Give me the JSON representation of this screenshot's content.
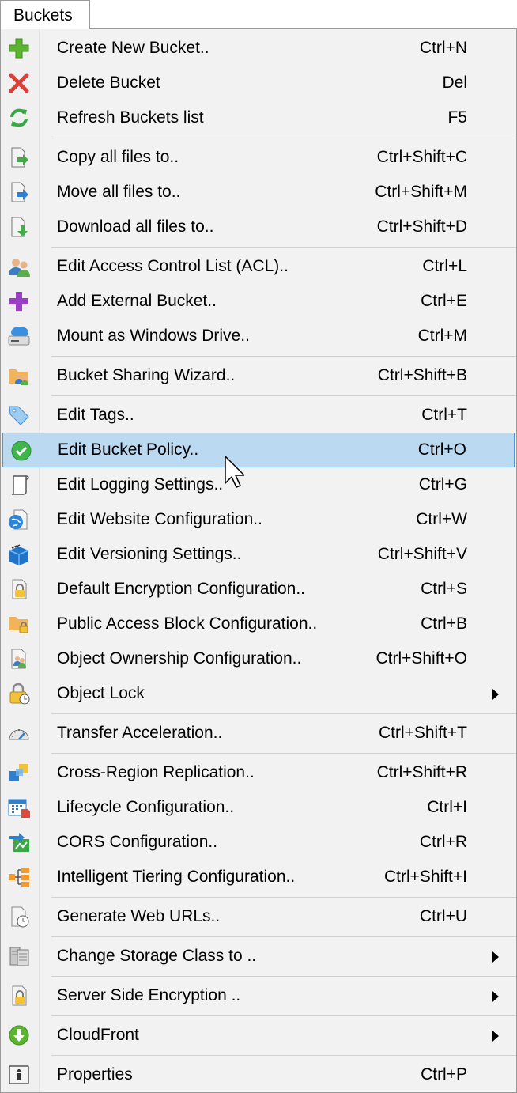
{
  "menu_title": "Buckets",
  "items": [
    {
      "label": "Create New Bucket..",
      "shortcut": "Ctrl+N",
      "icon": "plus-icon"
    },
    {
      "label": "Delete Bucket",
      "shortcut": "Del",
      "icon": "delete-x-icon"
    },
    {
      "label": "Refresh Buckets list",
      "shortcut": "F5",
      "icon": "refresh-icon"
    },
    {
      "label": "Copy all files to..",
      "shortcut": "Ctrl+Shift+C",
      "icon": "copy-files-icon"
    },
    {
      "label": "Move all files to..",
      "shortcut": "Ctrl+Shift+M",
      "icon": "move-files-icon"
    },
    {
      "label": "Download all files to..",
      "shortcut": "Ctrl+Shift+D",
      "icon": "download-files-icon"
    },
    {
      "label": "Edit Access Control List (ACL)..",
      "shortcut": "Ctrl+L",
      "icon": "users-icon"
    },
    {
      "label": "Add External Bucket..",
      "shortcut": "Ctrl+E",
      "icon": "purple-plus-icon"
    },
    {
      "label": "Mount as Windows Drive..",
      "shortcut": "Ctrl+M",
      "icon": "cloud-drive-icon"
    },
    {
      "label": "Bucket Sharing Wizard..",
      "shortcut": "Ctrl+Shift+B",
      "icon": "shared-folder-icon"
    },
    {
      "label": "Edit Tags..",
      "shortcut": "Ctrl+T",
      "icon": "tag-icon"
    },
    {
      "label": "Edit Bucket Policy..",
      "shortcut": "Ctrl+O",
      "icon": "check-circle-icon"
    },
    {
      "label": "Edit Logging Settings..",
      "shortcut": "Ctrl+G",
      "icon": "scroll-icon"
    },
    {
      "label": "Edit Website Configuration..",
      "shortcut": "Ctrl+W",
      "icon": "globe-page-icon"
    },
    {
      "label": "Edit Versioning Settings..",
      "shortcut": "Ctrl+Shift+V",
      "icon": "versioning-box-icon"
    },
    {
      "label": "Default Encryption Configuration..",
      "shortcut": "Ctrl+S",
      "icon": "lock-page-icon"
    },
    {
      "label": "Public Access Block Configuration..",
      "shortcut": "Ctrl+B",
      "icon": "locked-folder-icon"
    },
    {
      "label": "Object Ownership Configuration..",
      "shortcut": "Ctrl+Shift+O",
      "icon": "user-page-icon"
    },
    {
      "label": "Object Lock",
      "shortcut": "",
      "icon": "padlock-clock-icon"
    },
    {
      "label": "Transfer Acceleration..",
      "shortcut": "Ctrl+Shift+T",
      "icon": "speedometer-icon"
    },
    {
      "label": "Cross-Region Replication..",
      "shortcut": "Ctrl+Shift+R",
      "icon": "replication-icon"
    },
    {
      "label": "Lifecycle Configuration..",
      "shortcut": "Ctrl+I",
      "icon": "calendar-icon"
    },
    {
      "label": "CORS Configuration..",
      "shortcut": "Ctrl+R",
      "icon": "cors-icon"
    },
    {
      "label": "Intelligent Tiering Configuration..",
      "shortcut": "Ctrl+Shift+I",
      "icon": "tiering-icon"
    },
    {
      "label": "Generate Web URLs..",
      "shortcut": "Ctrl+U",
      "icon": "clock-page-icon"
    },
    {
      "label": "Change Storage Class to ..",
      "shortcut": "",
      "icon": "storage-class-icon"
    },
    {
      "label": "Server Side Encryption ..",
      "shortcut": "",
      "icon": "lock-document-icon"
    },
    {
      "label": "CloudFront",
      "shortcut": "",
      "icon": "cloudfront-down-icon"
    },
    {
      "label": "Properties",
      "shortcut": "Ctrl+P",
      "icon": "info-icon"
    }
  ]
}
